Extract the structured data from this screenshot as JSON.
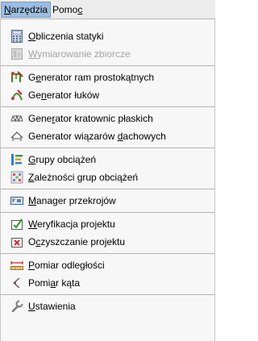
{
  "menubar": {
    "items": [
      {
        "pre": "",
        "u": "N",
        "post": "arzędzia"
      },
      {
        "pre": "Pomo",
        "u": "c",
        "post": ""
      }
    ]
  },
  "menu": {
    "items": [
      {
        "pre": "",
        "u": "O",
        "post": "bliczenia statyki",
        "icon": "calculator-icon"
      },
      {
        "pre": "",
        "u": "W",
        "post": "ymiarowanie zbiorcze",
        "icon": "bulk-dimensioning-icon"
      },
      {
        "pre": "G",
        "u": "e",
        "post": "nerator ram prostokątnych",
        "icon": "frame-generator-icon"
      },
      {
        "pre": "Ge",
        "u": "n",
        "post": "erator łuków",
        "icon": "arch-generator-icon"
      },
      {
        "pre": "Gene",
        "u": "r",
        "post": "ator kratownic płaskich",
        "icon": "truss-generator-icon"
      },
      {
        "pre": "Generator wiązarów ",
        "u": "d",
        "post": "achowych",
        "icon": "roof-truss-icon"
      },
      {
        "pre": "",
        "u": "G",
        "post": "rupy obciążeń",
        "icon": "load-groups-icon"
      },
      {
        "pre": "",
        "u": "Z",
        "post": "ależności grup obciążeń",
        "icon": "load-dependencies-icon"
      },
      {
        "pre": "",
        "u": "M",
        "post": "anager przekrojów",
        "icon": "section-manager-icon"
      },
      {
        "pre": "",
        "u": "W",
        "post": "eryfikacja projektu",
        "icon": "verify-icon"
      },
      {
        "pre": "O",
        "u": "c",
        "post": "zyszczanie projektu",
        "icon": "clean-icon"
      },
      {
        "pre": "",
        "u": "P",
        "post": "omiar odległości",
        "icon": "distance-ruler-icon"
      },
      {
        "pre": "Pomi",
        "u": "a",
        "post": "r kąta",
        "icon": "angle-icon"
      },
      {
        "pre": "",
        "u": "U",
        "post": "stawienia",
        "icon": "settings-icon"
      }
    ]
  }
}
